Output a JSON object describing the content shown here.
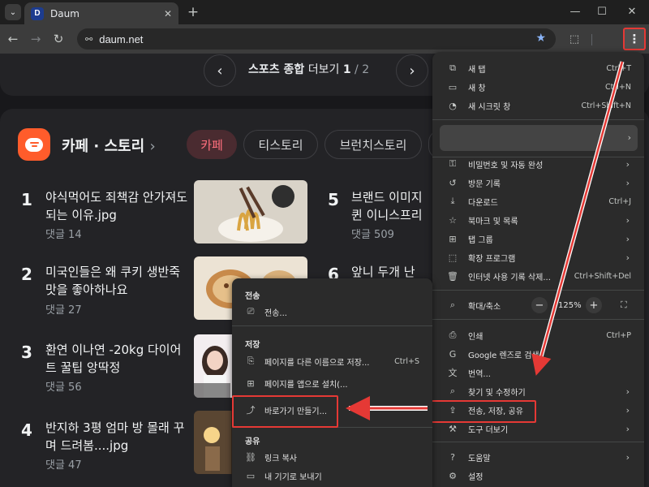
{
  "browser": {
    "tab_title": "Daum",
    "favicon_letter": "D",
    "url": "daum.net",
    "window_controls": {
      "minimize": "—",
      "maximize": "☐",
      "close": "✕"
    }
  },
  "page": {
    "sports": {
      "title": "스포츠 종합",
      "more": "더보기",
      "page": "1",
      "sep": "/",
      "total": "2"
    },
    "section_title": "카페 · 스토리",
    "section_chevron": "›",
    "tabs": [
      {
        "label": "카페",
        "active": true
      },
      {
        "label": "티스토리",
        "active": false
      },
      {
        "label": "브런치스토리",
        "active": false
      }
    ],
    "items": [
      {
        "rank": "1",
        "title": "야식먹어도 죄책감 안가져도 되는 이유.jpg",
        "meta": "댓글 14"
      },
      {
        "rank": "2",
        "title": "미국인들은 왜 쿠키 생반죽 맛을 좋아하나요",
        "meta": "댓글 27"
      },
      {
        "rank": "3",
        "title": "환연 이나연 -20kg 다이어트 꿀팁 앙딱정",
        "meta": "댓글 56"
      },
      {
        "rank": "4",
        "title": "반지하 3평 엄마 방 몰래 꾸며 드려봄....jpg",
        "meta": "댓글 47"
      },
      {
        "rank": "5",
        "title": "브랜드 이미지 퀸 이니스프리",
        "meta": "댓글 509"
      },
      {
        "rank": "6",
        "title": "앞니 두개 난",
        "meta": ""
      }
    ]
  },
  "menu": {
    "items": [
      {
        "icon": "⧉",
        "label": "새 탭",
        "shortcut": "Ctrl+T"
      },
      {
        "icon": "▭",
        "label": "새 창",
        "shortcut": "Ctrl+N"
      },
      {
        "icon": "◔",
        "label": "새 시크릿 창",
        "shortcut": "Ctrl+Shift+N"
      },
      {
        "icon": "⚿",
        "label": "비밀번호 및 자동 완성",
        "shortcut": ""
      },
      {
        "icon": "↺",
        "label": "방문 기록",
        "shortcut": ""
      },
      {
        "icon": "⤓",
        "label": "다운로드",
        "shortcut": "Ctrl+J"
      },
      {
        "icon": "☆",
        "label": "북마크 및 목록",
        "shortcut": ""
      },
      {
        "icon": "⊞",
        "label": "탭 그룹",
        "shortcut": ""
      },
      {
        "icon": "⬚",
        "label": "확장 프로그램",
        "shortcut": ""
      },
      {
        "icon": "🗑",
        "label": "인터넷 사용 기록 삭제...",
        "shortcut": "Ctrl+Shift+Del"
      },
      {
        "icon": "⌕",
        "label": "확대/축소",
        "shortcut": ""
      },
      {
        "icon": "⎙",
        "label": "인쇄",
        "shortcut": "Ctrl+P"
      },
      {
        "icon": "G",
        "label": "Google 렌즈로 검색",
        "shortcut": ""
      },
      {
        "icon": "文",
        "label": "번역...",
        "shortcut": ""
      },
      {
        "icon": "⌕",
        "label": "찾기 및 수정하기",
        "shortcut": ""
      },
      {
        "icon": "⇪",
        "label": "전송, 저장, 공유",
        "shortcut": ""
      },
      {
        "icon": "⚒",
        "label": "도구 더보기",
        "shortcut": ""
      },
      {
        "icon": "?",
        "label": "도움말",
        "shortcut": ""
      },
      {
        "icon": "⚙",
        "label": "설정",
        "shortcut": ""
      }
    ],
    "zoom": {
      "minus": "−",
      "value": "125%",
      "plus": "+"
    }
  },
  "submenu": {
    "send_heading": "전송",
    "cast_label": "전송...",
    "save_heading": "저장",
    "save_page_label": "페이지를 다른 이름으로 저장...",
    "save_page_shortcut": "Ctrl+S",
    "install_label": "페이지를 앱으로 설치(...",
    "shortcut_label": "바로가기 만들기...",
    "share_heading": "공유",
    "copy_link_label": "링크 복사",
    "send_device_label": "내 기기로 보내기"
  },
  "colors": {
    "annotation_red": "#e53935",
    "cafe_orange": "#ff5c2b",
    "active_tab_text": "#ff6f7d",
    "bookmark_star": "#8ab4f8"
  }
}
